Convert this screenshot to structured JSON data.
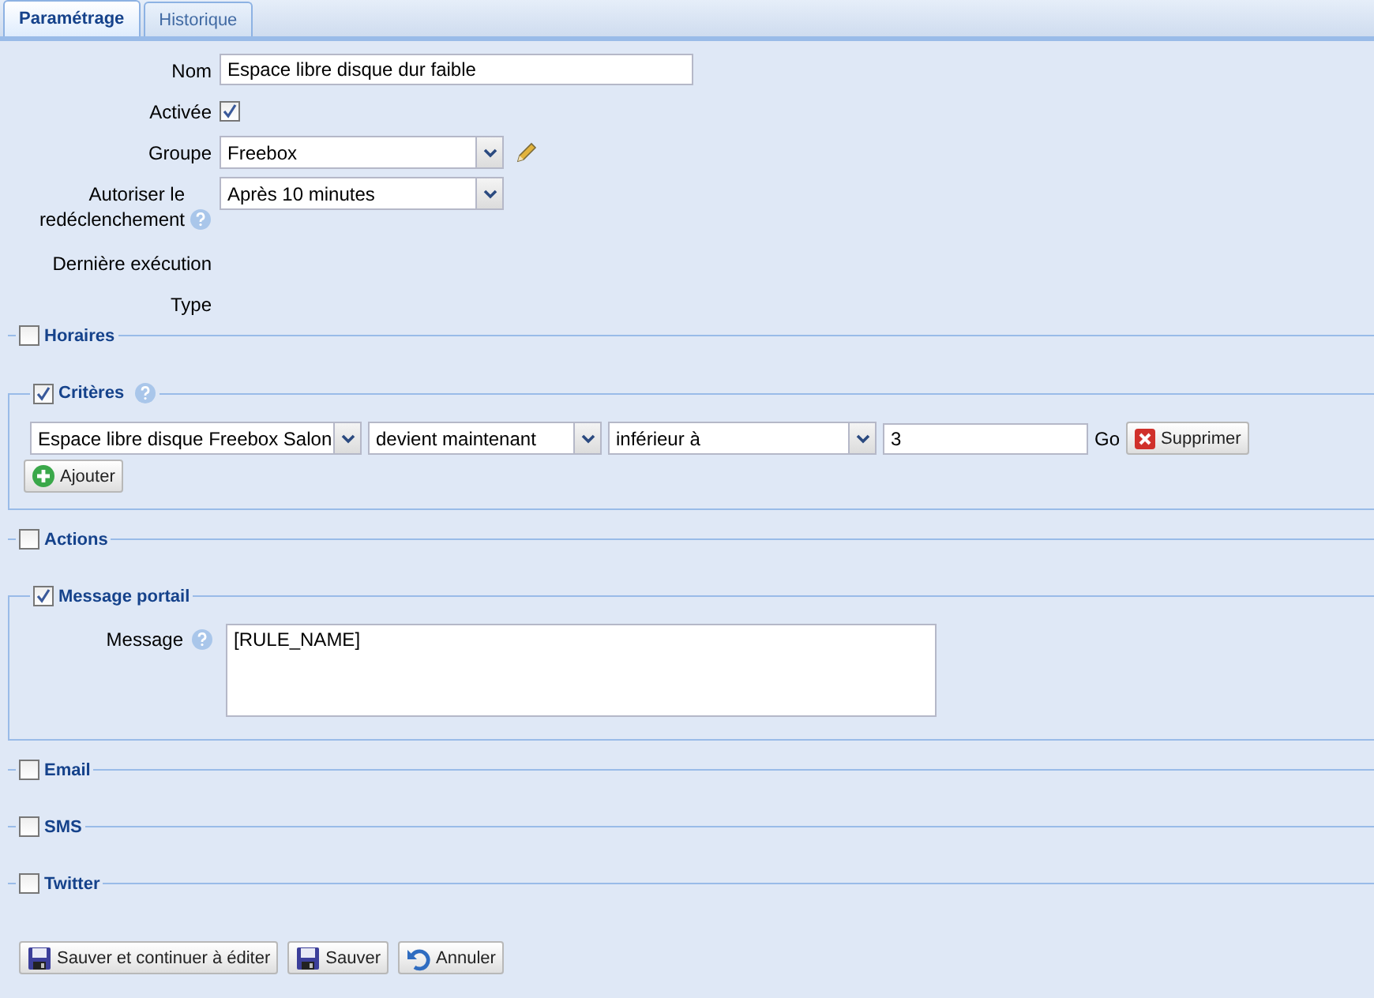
{
  "tabs": [
    {
      "label": "Paramétrage",
      "selected": true
    },
    {
      "label": "Historique",
      "selected": false
    }
  ],
  "fields": [
    {
      "kind": "text",
      "label": "Nom",
      "value": "Espace libre disque dur faible"
    },
    {
      "kind": "checkbox",
      "label": "Activée",
      "checked": true
    },
    {
      "kind": "select",
      "label": "Groupe",
      "value": "Freebox",
      "edit_icon": true
    },
    {
      "kind": "select",
      "label": "Autoriser le redéclenchement",
      "value": "Après 10 minutes",
      "help": true
    },
    {
      "kind": "info",
      "label": "Dernière exécution"
    },
    {
      "kind": "info",
      "label": "Type"
    }
  ],
  "sections": [
    {
      "title": "Horaires",
      "checked": false
    },
    {
      "title": "Critères",
      "checked": true,
      "help": true,
      "kind": "criteria",
      "criteria": [
        {
          "subject": "Espace libre disque Freebox Salon",
          "event": "devient maintenant",
          "comparator": "inférieur à",
          "value": "3",
          "go": "Go",
          "delete": "Supprimer"
        }
      ],
      "add": "Ajouter"
    },
    {
      "title": "Actions",
      "checked": false
    },
    {
      "title": "Message portail",
      "checked": true,
      "kind": "message",
      "label": "Message",
      "help": true,
      "value": "[RULE_NAME]"
    },
    {
      "title": "Email",
      "checked": false
    },
    {
      "title": "SMS",
      "checked": false
    },
    {
      "title": "Twitter",
      "checked": false
    }
  ],
  "buttons": [
    {
      "kind": "save",
      "label": "Sauver et continuer à éditer"
    },
    {
      "kind": "save",
      "label": "Sauver"
    },
    {
      "kind": "undo",
      "label": "Annuler"
    }
  ]
}
